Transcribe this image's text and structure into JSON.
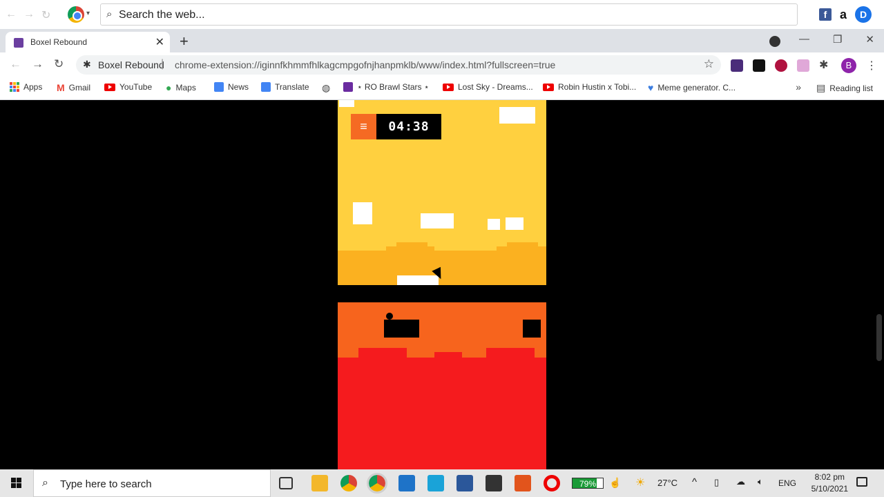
{
  "extension_bar": {
    "search_placeholder": "Search the web...",
    "icons": [
      "back-icon",
      "forward-icon",
      "refresh-icon",
      "chrome-icon",
      "facebook-icon",
      "amazon-icon",
      "ddg-icon"
    ],
    "amazon_label": "a",
    "ddg_label": "D",
    "facebook_label": "f"
  },
  "tabs": [
    {
      "title": "Boxel Rebound",
      "active": true
    }
  ],
  "address_bar": {
    "origin": "Boxel Rebound",
    "separator": "|",
    "url": "chrome-extension://iginnfkhmmfhlkagcmpgofnjhanpmklb/www/index.html?fullscreen=true",
    "profile_initial": "B"
  },
  "bookmarks": [
    {
      "label": "Apps"
    },
    {
      "label": "Gmail"
    },
    {
      "label": "YouTube"
    },
    {
      "label": "Maps"
    },
    {
      "label": "News"
    },
    {
      "label": "Translate"
    },
    {
      "label": ""
    },
    {
      "label": "⋆ RO Brawl Stars ⋆"
    },
    {
      "label": "Lost Sky - Dreams..."
    },
    {
      "label": "Robin Hustin x Tobi..."
    },
    {
      "label": "Meme generator. C..."
    }
  ],
  "reading_list": "Reading list",
  "game": {
    "timer": "04:38",
    "menu_icon": "≡",
    "colors": {
      "sky": "#ffd03f",
      "dune": "#fbb120",
      "lava_sky": "#f7641d",
      "lava": "#f51b1e",
      "menu": "#f56a23"
    }
  },
  "taskbar": {
    "search_placeholder": "Type here to search",
    "battery_percent": "79%",
    "battery_level": 0.79,
    "temperature": "27°C",
    "language": "ENG",
    "time": "8:02 pm",
    "date": "5/10/2021"
  }
}
